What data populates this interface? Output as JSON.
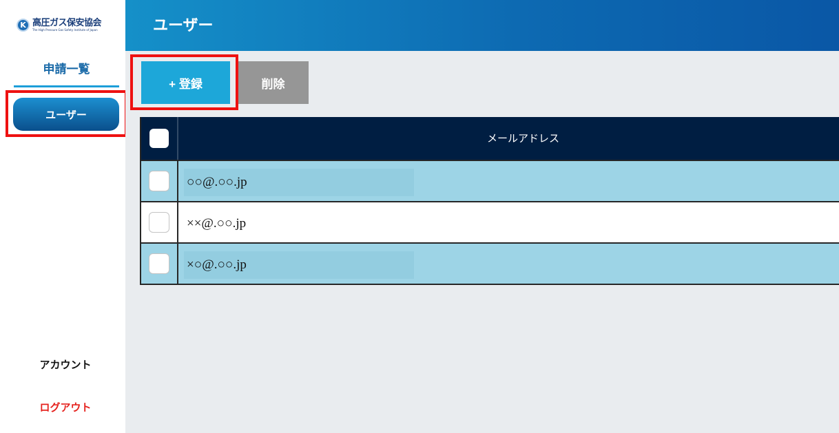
{
  "sidebar": {
    "logo_jp": "高圧ガス保安協会",
    "logo_en": "The High Pressure Gas Safety Institute of Japan",
    "logo_mark": "K",
    "nav_apply": "申請一覧",
    "nav_user": "ユーザー",
    "nav_account": "アカウント",
    "nav_logout": "ログアウト"
  },
  "header": {
    "title": "ユーザー"
  },
  "toolbar": {
    "register_label": "+ 登録",
    "delete_label": "削除"
  },
  "table": {
    "columns": [
      "メールアドレス"
    ],
    "rows": [
      {
        "email": "○○@.○○.jp",
        "checked": false
      },
      {
        "email": "××@.○○.jp",
        "checked": false
      },
      {
        "email": "×○@.○○.jp",
        "checked": false
      }
    ]
  },
  "colors": {
    "header_blue": "#0d6ab2",
    "accent_cyan": "#1da7d9",
    "table_head": "#001e42",
    "row_highlight": "#9dd4e6",
    "highlight_red": "#ee1111",
    "logout_red": "#e5221e"
  },
  "icons": {
    "logo": "jkhpgsi-logo-icon"
  }
}
